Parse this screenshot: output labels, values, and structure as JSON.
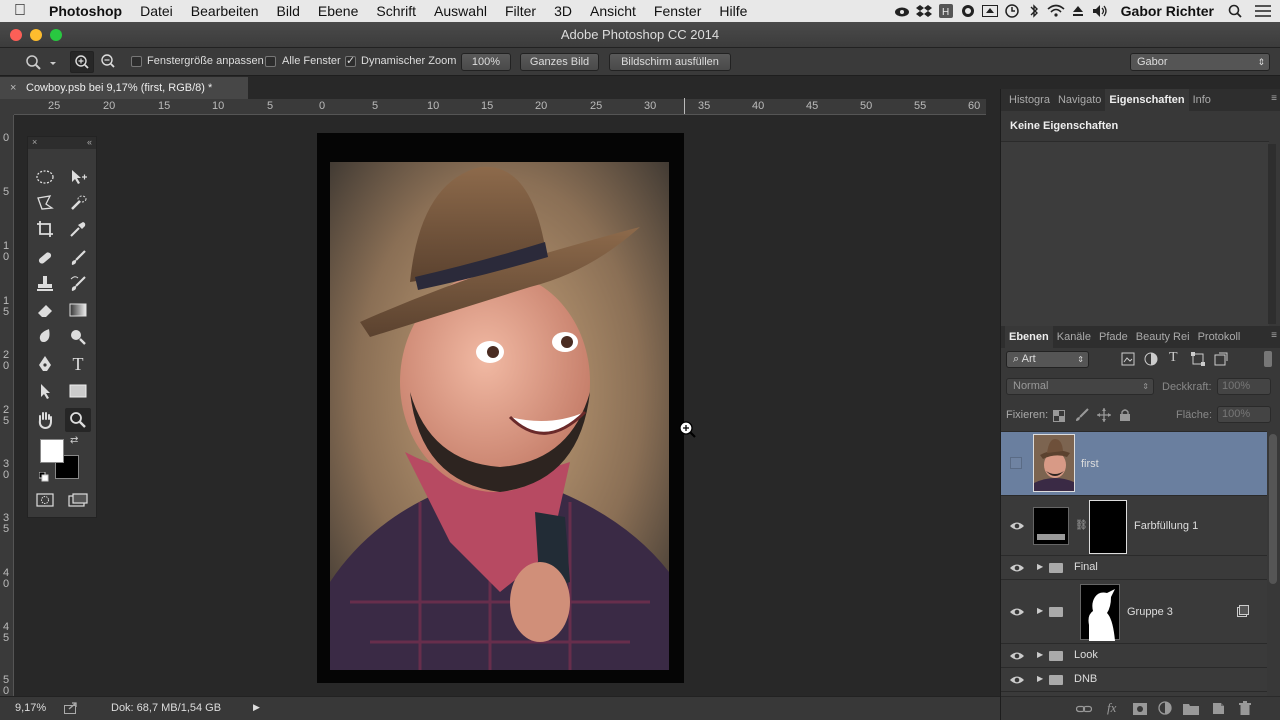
{
  "menubar": {
    "app": "Photoshop",
    "items": [
      "Datei",
      "Bearbeiten",
      "Bild",
      "Ebene",
      "Schrift",
      "Auswahl",
      "Filter",
      "3D",
      "Ansicht",
      "Fenster",
      "Hilfe"
    ],
    "user": "Gabor Richter"
  },
  "window": {
    "title": "Adobe Photoshop CC 2014"
  },
  "options": {
    "fit_window": "Fenstergröße anpassen",
    "all_windows": "Alle Fenster",
    "dynamic_zoom": "Dynamischer Zoom",
    "zoom_100": "100%",
    "fit_screen": "Ganzes Bild",
    "fill_screen": "Bildschirm ausfüllen",
    "workspace": "Gabor"
  },
  "document": {
    "tab": "Cowboy.psb bei 9,17% (first, RGB/8) *"
  },
  "rulers": {
    "h": [
      "25",
      "20",
      "15",
      "10",
      "5",
      "0",
      "5",
      "10",
      "15",
      "20",
      "25",
      "30",
      "35",
      "40",
      "45",
      "50",
      "55",
      "60"
    ],
    "v": [
      "0",
      "5",
      "1\n0",
      "1\n5",
      "2\n0",
      "2\n5",
      "3\n0",
      "3\n5",
      "4\n0",
      "4\n5",
      "5\n0"
    ]
  },
  "properties_panel": {
    "tabs": [
      "Histogra",
      "Navigato",
      "Eigenschaften",
      "Info"
    ],
    "content": "Keine Eigenschaften"
  },
  "layers_panel": {
    "tabs": [
      "Ebenen",
      "Kanäle",
      "Pfade",
      "Beauty Rei",
      "Protokoll"
    ],
    "filter": "Art",
    "blend_mode": "Normal",
    "opacity_label": "Deckkraft:",
    "opacity": "100%",
    "lock_label": "Fixieren:",
    "fill_label": "Fläche:",
    "fill": "100%",
    "layers": [
      {
        "name": "first"
      },
      {
        "name": "Farbfüllung 1"
      },
      {
        "name": "Final"
      },
      {
        "name": "Gruppe 3"
      },
      {
        "name": "Look"
      },
      {
        "name": "DNB"
      }
    ]
  },
  "status": {
    "zoom": "9,17%",
    "doc": "Dok: 68,7 MB/1,54 GB"
  }
}
